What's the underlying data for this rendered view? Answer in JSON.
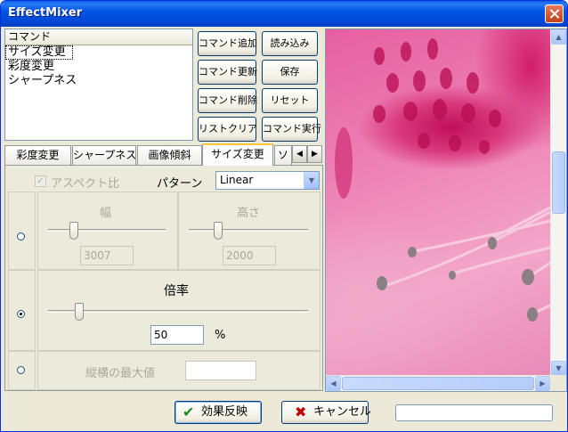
{
  "window": {
    "title": "EffectMixer"
  },
  "command_list": {
    "header": "コマンド",
    "items": [
      "サイズ変更",
      "彩度変更",
      "シャープネス"
    ],
    "selected_index": 0
  },
  "buttons": {
    "add_command": "コマンド追加",
    "load": "読み込み",
    "update_command": "コマンド更新",
    "save": "保存",
    "delete_command": "コマンド削除",
    "reset": "リセット",
    "clear_list": "リストクリア",
    "run_command": "コマンド実行"
  },
  "tabs": [
    "彩度変更",
    "シャープネス",
    "画像傾斜",
    "サイズ変更",
    "ソ"
  ],
  "active_tab_index": 3,
  "resize_panel": {
    "aspect_ratio_label": "アスペクト比",
    "aspect_ratio_checked": true,
    "pattern_label": "パターン",
    "pattern_value": "Linear",
    "width_label": "幅",
    "width_value": "3007",
    "height_label": "高さ",
    "height_value": "2000",
    "scale_label": "倍率",
    "scale_value": "50",
    "scale_unit": "%",
    "max_side_label": "縦横の最大値",
    "max_side_value": "",
    "selected_mode": "scale"
  },
  "footer": {
    "apply_label": "効果反映",
    "cancel_label": "キャンセル",
    "progress": 0
  },
  "colors": {
    "titlebar": "#0054e3",
    "accent_tab": "#ffc83c",
    "apply_check": "#1d8b1d",
    "cancel_x": "#c00000"
  }
}
